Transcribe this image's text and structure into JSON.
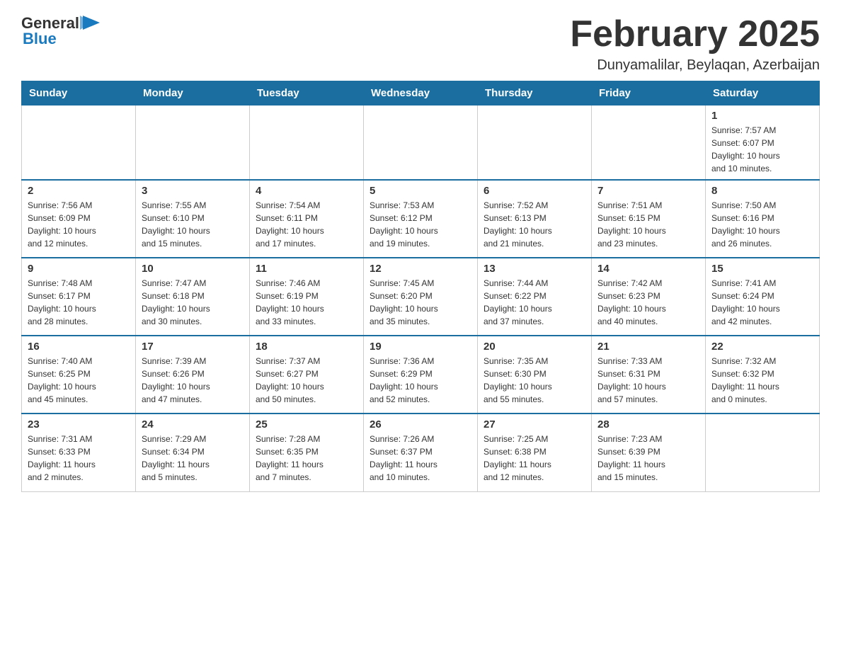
{
  "header": {
    "logo_general": "General",
    "logo_blue": "Blue",
    "title": "February 2025",
    "subtitle": "Dunyamalilar, Beylaqan, Azerbaijan"
  },
  "weekdays": [
    "Sunday",
    "Monday",
    "Tuesday",
    "Wednesday",
    "Thursday",
    "Friday",
    "Saturday"
  ],
  "weeks": [
    [
      {
        "day": "",
        "info": ""
      },
      {
        "day": "",
        "info": ""
      },
      {
        "day": "",
        "info": ""
      },
      {
        "day": "",
        "info": ""
      },
      {
        "day": "",
        "info": ""
      },
      {
        "day": "",
        "info": ""
      },
      {
        "day": "1",
        "info": "Sunrise: 7:57 AM\nSunset: 6:07 PM\nDaylight: 10 hours\nand 10 minutes."
      }
    ],
    [
      {
        "day": "2",
        "info": "Sunrise: 7:56 AM\nSunset: 6:09 PM\nDaylight: 10 hours\nand 12 minutes."
      },
      {
        "day": "3",
        "info": "Sunrise: 7:55 AM\nSunset: 6:10 PM\nDaylight: 10 hours\nand 15 minutes."
      },
      {
        "day": "4",
        "info": "Sunrise: 7:54 AM\nSunset: 6:11 PM\nDaylight: 10 hours\nand 17 minutes."
      },
      {
        "day": "5",
        "info": "Sunrise: 7:53 AM\nSunset: 6:12 PM\nDaylight: 10 hours\nand 19 minutes."
      },
      {
        "day": "6",
        "info": "Sunrise: 7:52 AM\nSunset: 6:13 PM\nDaylight: 10 hours\nand 21 minutes."
      },
      {
        "day": "7",
        "info": "Sunrise: 7:51 AM\nSunset: 6:15 PM\nDaylight: 10 hours\nand 23 minutes."
      },
      {
        "day": "8",
        "info": "Sunrise: 7:50 AM\nSunset: 6:16 PM\nDaylight: 10 hours\nand 26 minutes."
      }
    ],
    [
      {
        "day": "9",
        "info": "Sunrise: 7:48 AM\nSunset: 6:17 PM\nDaylight: 10 hours\nand 28 minutes."
      },
      {
        "day": "10",
        "info": "Sunrise: 7:47 AM\nSunset: 6:18 PM\nDaylight: 10 hours\nand 30 minutes."
      },
      {
        "day": "11",
        "info": "Sunrise: 7:46 AM\nSunset: 6:19 PM\nDaylight: 10 hours\nand 33 minutes."
      },
      {
        "day": "12",
        "info": "Sunrise: 7:45 AM\nSunset: 6:20 PM\nDaylight: 10 hours\nand 35 minutes."
      },
      {
        "day": "13",
        "info": "Sunrise: 7:44 AM\nSunset: 6:22 PM\nDaylight: 10 hours\nand 37 minutes."
      },
      {
        "day": "14",
        "info": "Sunrise: 7:42 AM\nSunset: 6:23 PM\nDaylight: 10 hours\nand 40 minutes."
      },
      {
        "day": "15",
        "info": "Sunrise: 7:41 AM\nSunset: 6:24 PM\nDaylight: 10 hours\nand 42 minutes."
      }
    ],
    [
      {
        "day": "16",
        "info": "Sunrise: 7:40 AM\nSunset: 6:25 PM\nDaylight: 10 hours\nand 45 minutes."
      },
      {
        "day": "17",
        "info": "Sunrise: 7:39 AM\nSunset: 6:26 PM\nDaylight: 10 hours\nand 47 minutes."
      },
      {
        "day": "18",
        "info": "Sunrise: 7:37 AM\nSunset: 6:27 PM\nDaylight: 10 hours\nand 50 minutes."
      },
      {
        "day": "19",
        "info": "Sunrise: 7:36 AM\nSunset: 6:29 PM\nDaylight: 10 hours\nand 52 minutes."
      },
      {
        "day": "20",
        "info": "Sunrise: 7:35 AM\nSunset: 6:30 PM\nDaylight: 10 hours\nand 55 minutes."
      },
      {
        "day": "21",
        "info": "Sunrise: 7:33 AM\nSunset: 6:31 PM\nDaylight: 10 hours\nand 57 minutes."
      },
      {
        "day": "22",
        "info": "Sunrise: 7:32 AM\nSunset: 6:32 PM\nDaylight: 11 hours\nand 0 minutes."
      }
    ],
    [
      {
        "day": "23",
        "info": "Sunrise: 7:31 AM\nSunset: 6:33 PM\nDaylight: 11 hours\nand 2 minutes."
      },
      {
        "day": "24",
        "info": "Sunrise: 7:29 AM\nSunset: 6:34 PM\nDaylight: 11 hours\nand 5 minutes."
      },
      {
        "day": "25",
        "info": "Sunrise: 7:28 AM\nSunset: 6:35 PM\nDaylight: 11 hours\nand 7 minutes."
      },
      {
        "day": "26",
        "info": "Sunrise: 7:26 AM\nSunset: 6:37 PM\nDaylight: 11 hours\nand 10 minutes."
      },
      {
        "day": "27",
        "info": "Sunrise: 7:25 AM\nSunset: 6:38 PM\nDaylight: 11 hours\nand 12 minutes."
      },
      {
        "day": "28",
        "info": "Sunrise: 7:23 AM\nSunset: 6:39 PM\nDaylight: 11 hours\nand 15 minutes."
      },
      {
        "day": "",
        "info": ""
      }
    ]
  ]
}
